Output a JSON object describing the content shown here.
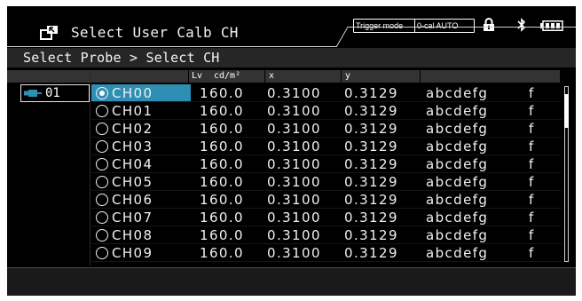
{
  "header": {
    "title": "Select User Calb CH",
    "title_icon": "window-select-icon",
    "badges": {
      "trigger": "Trigger mode",
      "ocal": "0-cal AUTO"
    },
    "status_icons": [
      "lock-icon",
      "bluetooth-icon",
      "battery-icon"
    ]
  },
  "breadcrumb": "Select Probe > Select CH",
  "columns": {
    "lv": "Lv",
    "unit": "cd/m²",
    "x": "x",
    "y": "y"
  },
  "probe": {
    "label": "01",
    "icon": "probe-plug-icon"
  },
  "rows": [
    {
      "ch": "CH00",
      "lv": "160.0",
      "x": "0.3100",
      "y": "0.3129",
      "name": "abcdefg",
      "flag": "f"
    },
    {
      "ch": "CH01",
      "lv": "160.0",
      "x": "0.3100",
      "y": "0.3129",
      "name": "abcdefg",
      "flag": "f"
    },
    {
      "ch": "CH02",
      "lv": "160.0",
      "x": "0.3100",
      "y": "0.3129",
      "name": "abcdefg",
      "flag": "f"
    },
    {
      "ch": "CH03",
      "lv": "160.0",
      "x": "0.3100",
      "y": "0.3129",
      "name": "abcdefg",
      "flag": "f"
    },
    {
      "ch": "CH04",
      "lv": "160.0",
      "x": "0.3100",
      "y": "0.3129",
      "name": "abcdefg",
      "flag": "f"
    },
    {
      "ch": "CH05",
      "lv": "160.0",
      "x": "0.3100",
      "y": "0.3129",
      "name": "abcdefg",
      "flag": "f"
    },
    {
      "ch": "CH06",
      "lv": "160.0",
      "x": "0.3100",
      "y": "0.3129",
      "name": "abcdefg",
      "flag": "f"
    },
    {
      "ch": "CH07",
      "lv": "160.0",
      "x": "0.3100",
      "y": "0.3129",
      "name": "abcdefg",
      "flag": "f"
    },
    {
      "ch": "CH08",
      "lv": "160.0",
      "x": "0.3100",
      "y": "0.3129",
      "name": "abcdefg",
      "flag": "f"
    },
    {
      "ch": "CH09",
      "lv": "160.0",
      "x": "0.3100",
      "y": "0.3129",
      "name": "abcdefg",
      "flag": "f"
    }
  ],
  "selected_index": 0,
  "colors": {
    "accent": "#2e8fb4",
    "background": "#000000",
    "text": "#f0f0f0"
  }
}
